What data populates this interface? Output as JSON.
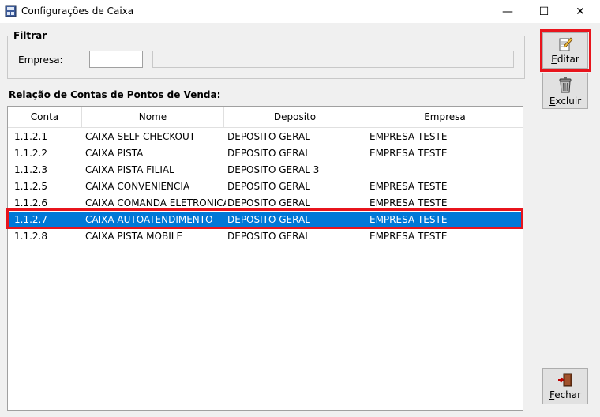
{
  "window": {
    "title": "Configurações de Caixa",
    "minimize_glyph": "—",
    "maximize_glyph": "☐",
    "close_glyph": "✕"
  },
  "filter": {
    "legend": "Filtrar",
    "empresa_label": "Empresa:",
    "empresa_code": "",
    "empresa_name": ""
  },
  "list": {
    "label": "Relação de Contas de Pontos de Venda:",
    "columns": [
      "Conta",
      "Nome",
      "Deposito",
      "Empresa"
    ],
    "rows": [
      [
        "1.1.2.1",
        "CAIXA SELF CHECKOUT",
        "DEPOSITO GERAL",
        "EMPRESA TESTE"
      ],
      [
        "1.1.2.2",
        "CAIXA PISTA",
        "DEPOSITO GERAL",
        "EMPRESA TESTE"
      ],
      [
        "1.1.2.3",
        "CAIXA PISTA FILIAL",
        "DEPOSITO GERAL 3",
        ""
      ],
      [
        "1.1.2.5",
        "CAIXA CONVENIENCIA",
        "DEPOSITO GERAL",
        "EMPRESA TESTE"
      ],
      [
        "1.1.2.6",
        "CAIXA COMANDA ELETRONICA",
        "DEPOSITO GERAL",
        "EMPRESA TESTE"
      ],
      [
        "1.1.2.7",
        "CAIXA AUTOATENDIMENTO",
        "DEPOSITO GERAL",
        "EMPRESA TESTE"
      ],
      [
        "1.1.2.8",
        "CAIXA PISTA MOBILE",
        "DEPOSITO GERAL",
        "EMPRESA TESTE"
      ]
    ],
    "selected_index": 5
  },
  "buttons": {
    "edit_first": "E",
    "edit_rest": "ditar",
    "delete_first": "E",
    "delete_rest": "xcluir",
    "close_first": "F",
    "close_rest": "echar"
  },
  "colors": {
    "selection": "#0078d7",
    "highlight": "#e8141c"
  },
  "icons": {
    "app": "app-window-icon",
    "edit": "notepad-pencil-icon",
    "delete": "trash-can-icon",
    "close": "exit-door-icon"
  }
}
